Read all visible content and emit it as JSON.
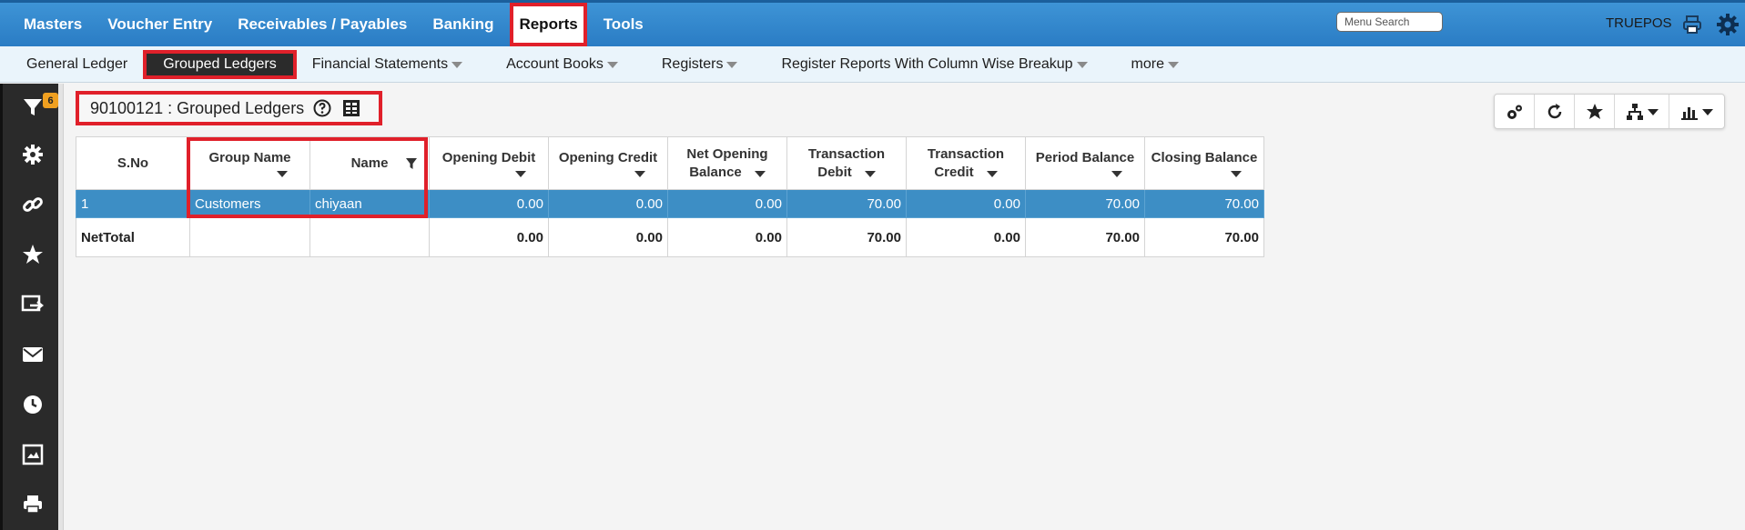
{
  "topnav": {
    "items": [
      "Masters",
      "Voucher Entry",
      "Receivables / Payables",
      "Banking",
      "Reports",
      "Tools"
    ],
    "active_index": 4,
    "search_placeholder": "Menu Search",
    "brand": "TRUEPOS"
  },
  "subnav": {
    "items": [
      {
        "label": "General Ledger",
        "dropdown": false
      },
      {
        "label": "Grouped Ledgers",
        "dropdown": false
      },
      {
        "label": "Financial Statements",
        "dropdown": true
      },
      {
        "label": "Account Books",
        "dropdown": true
      },
      {
        "label": "Registers",
        "dropdown": true
      },
      {
        "label": "Register Reports With Column Wise Breakup",
        "dropdown": true
      },
      {
        "label": "more",
        "dropdown": true
      }
    ],
    "active_index": 1
  },
  "sidebar": {
    "icons": [
      "filter-icon",
      "gear-icon",
      "link-icon",
      "star-icon",
      "export-icon",
      "mail-icon",
      "clock-icon",
      "image-icon",
      "print-icon"
    ],
    "filter_badge": "6"
  },
  "report": {
    "title": "90100121 : Grouped Ledgers"
  },
  "table": {
    "columns": [
      {
        "l1": "S.No",
        "l2": "",
        "caret": false
      },
      {
        "l1": "Group Name",
        "l2": "",
        "caret": true
      },
      {
        "l1": "Name",
        "l2": "",
        "caret": false,
        "filter": true
      },
      {
        "l1": "Opening Debit",
        "l2": "",
        "caret": true
      },
      {
        "l1": "Opening Credit",
        "l2": "",
        "caret": true
      },
      {
        "l1": "Net Opening",
        "l2": "Balance",
        "caret": true
      },
      {
        "l1": "Transaction",
        "l2": "Debit",
        "caret": true
      },
      {
        "l1": "Transaction",
        "l2": "Credit",
        "caret": true
      },
      {
        "l1": "Period Balance",
        "l2": "",
        "caret": true
      },
      {
        "l1": "Closing Balance",
        "l2": "",
        "caret": true
      }
    ],
    "rows": [
      [
        "1",
        "Customers",
        "chiyaan",
        "0.00",
        "0.00",
        "0.00",
        "70.00",
        "0.00",
        "70.00",
        "70.00"
      ]
    ],
    "total": [
      "NetTotal",
      "",
      "",
      "0.00",
      "0.00",
      "0.00",
      "70.00",
      "0.00",
      "70.00",
      "70.00"
    ]
  },
  "colors": {
    "topbar": "#2a7cc4",
    "selected_row": "#3d8ec5",
    "highlight": "#e0202a",
    "sidebar": "#2a2a2a",
    "badge": "#f0a020"
  }
}
